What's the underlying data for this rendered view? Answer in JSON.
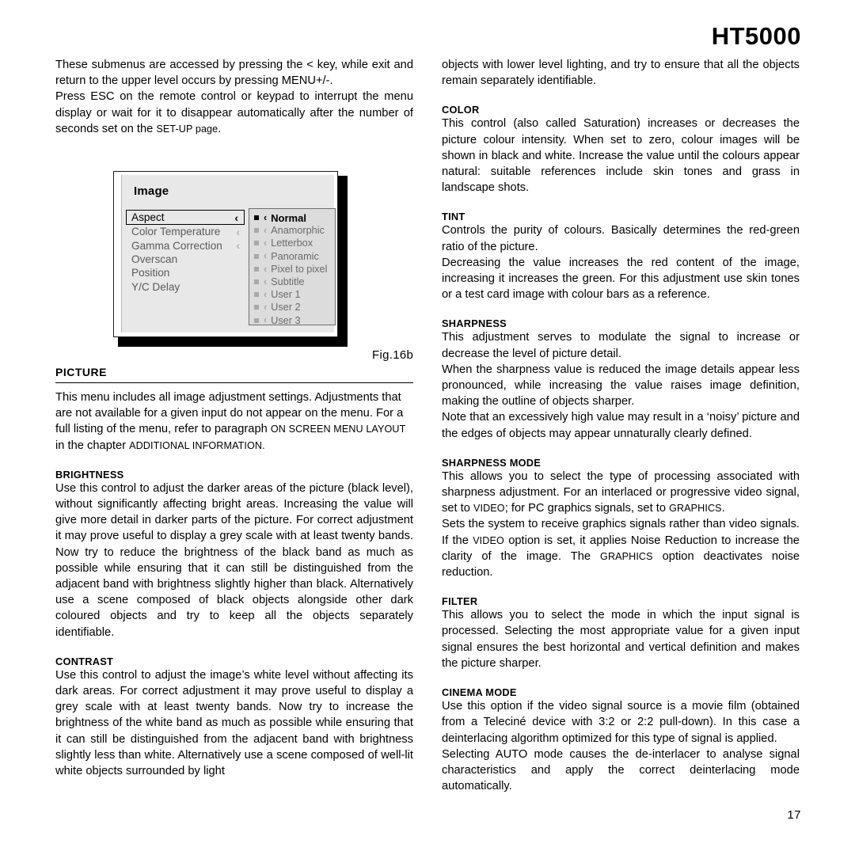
{
  "header": {
    "model": "HT5000"
  },
  "footer": {
    "page_number": "17"
  },
  "figure": {
    "caption": "Fig.16b",
    "title": "Image",
    "left_menu": [
      {
        "label": "Aspect",
        "chevron": "‹",
        "selected": true
      },
      {
        "label": "Color  Temperature",
        "chevron": "‹",
        "selected": false
      },
      {
        "label": "Gamma Correction",
        "chevron": "‹",
        "selected": false
      },
      {
        "label": "Overscan",
        "chevron": "",
        "selected": false
      },
      {
        "label": "Position",
        "chevron": "",
        "selected": false
      },
      {
        "label": "Y/C Delay",
        "chevron": "",
        "selected": false
      }
    ],
    "submenu": [
      {
        "label": "Normal",
        "chevron": "‹",
        "active": true
      },
      {
        "label": "Anamorphic",
        "chevron": "‹",
        "active": false
      },
      {
        "label": "Letterbox",
        "chevron": "‹",
        "active": false
      },
      {
        "label": "Panoramic",
        "chevron": "‹",
        "active": false
      },
      {
        "label": "Pixel to pixel",
        "chevron": "‹",
        "active": false
      },
      {
        "label": "Subtitle",
        "chevron": "‹",
        "active": false
      },
      {
        "label": "User 1",
        "chevron": "‹",
        "active": false
      },
      {
        "label": "User 2",
        "chevron": "‹",
        "active": false
      },
      {
        "label": "User 3",
        "chevron": "‹",
        "active": false
      }
    ]
  },
  "left_column": {
    "intro_para_1": "These submenus are accessed by pressing the < key, while exit and return to the upper level occurs by pressing MENU+/-.",
    "intro_para_2a": "Press ESC on the remote control or keypad to interrupt the menu display or wait for it to disappear automatically after the number of seconds set on the ",
    "intro_para_2_sc": "SET-UP page",
    "intro_para_2b": ".",
    "picture_heading": "PICTURE",
    "picture_body_a": "This menu includes all image adjustment settings. Adjustments that are not available for a given input do not appear on the menu. For a full listing of the menu, refer to paragraph ",
    "picture_body_sc1": "ON SCREEN MENU LAYOUT",
    "picture_body_b": "  in the chapter ",
    "picture_body_sc2": "ADDITIONAL INFORMATION.",
    "brightness_heading": "BRIGHTNESS",
    "brightness_body": "Use this control to adjust the darker areas of the picture (black level), without significantly affecting bright areas. Increasing the value will give more detail in darker parts of the picture. For correct adjustment it may prove useful to display a grey scale with at least twenty bands. Now try to reduce the brightness of the black band as much as possible while ensuring that it can still be distinguished from the adjacent band with brightness slightly higher than black. Alternatively use a scene composed of black objects alongside other dark coloured objects and try to keep all the objects separately identifiable.",
    "contrast_heading": "CONTRAST",
    "contrast_body": "Use this control to adjust the image’s white level without affecting its dark areas. For correct adjustment it may prove useful to display a grey scale with at least twenty bands. Now try to increase the brightness of the white band as much as possible while ensuring that it can still be distinguished from the adjacent band with brightness slightly less than white. Alternatively use a scene composed of well-lit white objects surrounded by light"
  },
  "right_column": {
    "continued_body": "objects with lower level lighting, and try to ensure that all the objects remain separately identifiable.",
    "color_heading": "COLOR",
    "color_body": "This control (also called Saturation) increases or decreases the picture colour intensity. When set to zero, colour images will be shown in black and white. Increase the value until the colours appear natural: suitable references include skin tones and grass in landscape shots.",
    "tint_heading": "TINT",
    "tint_body_1": "Controls the purity of colours. Basically determines the red-green ratio of the picture.",
    "tint_body_2": "Decreasing the value increases the red content of the image, increasing it increases the green. For this adjustment use skin tones or a test card image with colour bars as a reference.",
    "sharpness_heading": "SHARPNESS",
    "sharpness_body_1": "This adjustment serves to modulate the signal to increase or decrease the level of picture detail.",
    "sharpness_body_2": "When the sharpness value is reduced the image details appear less pronounced, while increasing the value raises image definition, making the outline of objects sharper.",
    "sharpness_body_3": "Note that an excessively high value may result in a ‘noisy’ picture and the edges of objects may appear unnaturally clearly defined.",
    "sharpness_mode_heading": "SHARPNESS MODE",
    "sharpness_mode_body_1a": "This allows you to select the type of processing associated with sharpness adjustment. For an interlaced or progressive video signal, set to ",
    "sharpness_mode_sc1": "VIDEO",
    "sharpness_mode_body_1b": "; for PC graphics signals, set to ",
    "sharpness_mode_sc2": "GRAPHICS",
    "sharpness_mode_body_1c": ".",
    "sharpness_mode_body_2a": "Sets the system to receive graphics signals rather than video signals. If the ",
    "sharpness_mode_sc3": "VIDEO",
    "sharpness_mode_body_2b": " option is set, it applies Noise Reduction to increase the clarity of the image. The  ",
    "sharpness_mode_sc4": "GRAPHICS",
    "sharpness_mode_body_2c": " option deactivates noise reduction.",
    "filter_heading": "FILTER",
    "filter_body": "This allows you to select the mode in which the input signal is processed. Selecting the most appropriate value for a given input signal ensures the best horizontal and vertical definition and makes the picture sharper.",
    "cinema_mode_heading": "CINEMA MODE",
    "cinema_mode_body_1": "Use this option if the video signal source is a movie film (obtained from a Teleciné device with 3:2 or 2:2 pull-down). In this case a deinterlacing algorithm optimized for this type of signal is applied.",
    "cinema_mode_body_2": "Selecting AUTO mode causes the de-interlacer to analyse signal characteristics and apply the correct deinterlacing mode automatically."
  }
}
